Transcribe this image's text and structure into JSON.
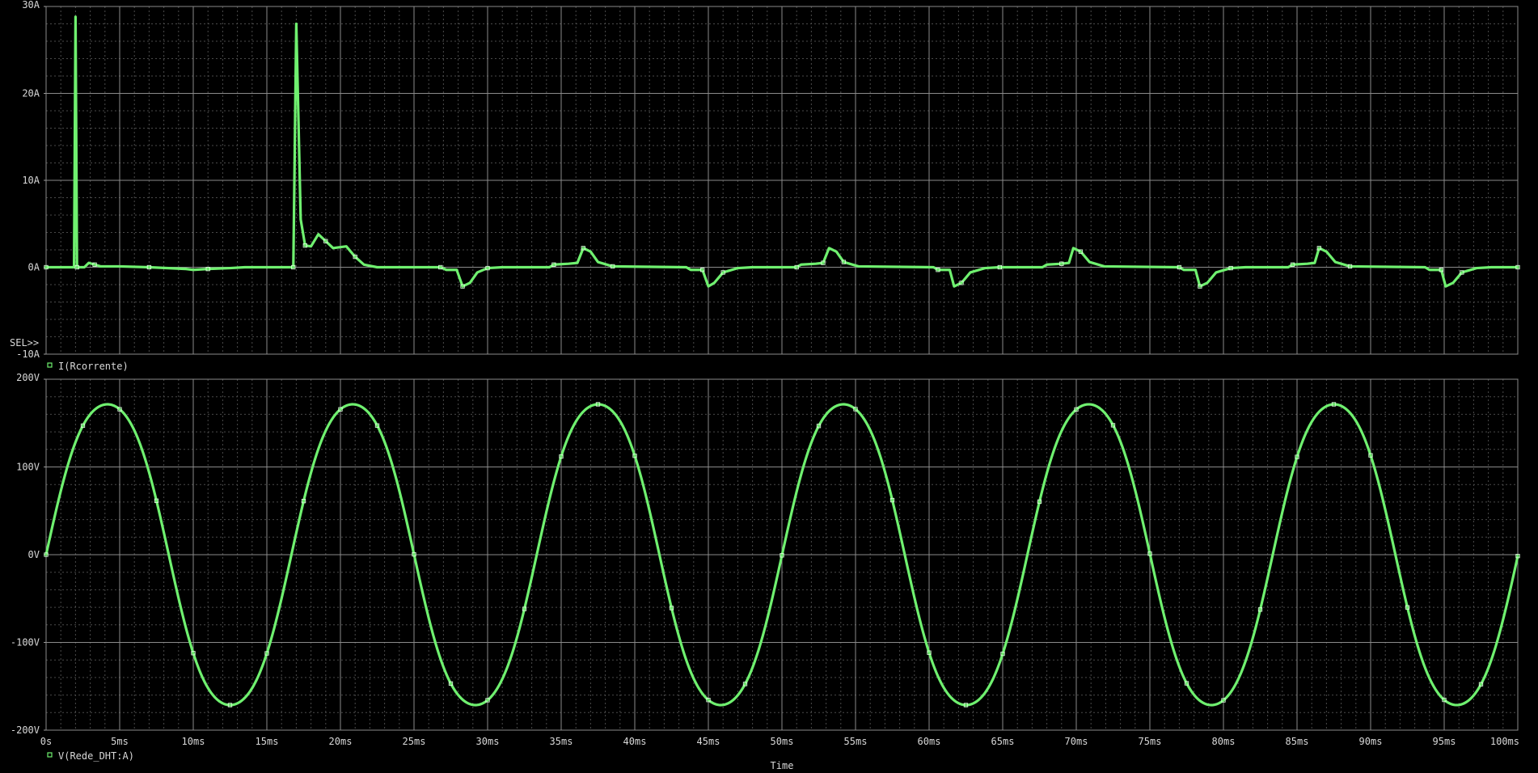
{
  "chart_data": [
    {
      "type": "line",
      "title": "",
      "xlabel": "",
      "ylabel": "",
      "xlim": [
        0,
        100
      ],
      "ylim": [
        -10,
        30
      ],
      "y_ticks": [
        "30A",
        "20A",
        "10A",
        "0A",
        "-10A"
      ],
      "y_tick_values": [
        30,
        20,
        10,
        0,
        -10
      ],
      "grid": true,
      "selection_marker": "SEL>>",
      "series": [
        {
          "name": "I(Rcorrente)",
          "color": "#6ff06f",
          "points": [
            [
              0,
              0
            ],
            [
              1.9,
              0
            ],
            [
              2.0,
              28.8
            ],
            [
              2.1,
              0
            ],
            [
              2.6,
              0
            ],
            [
              2.9,
              0.5
            ],
            [
              3.3,
              0.3
            ],
            [
              3.7,
              0.1
            ],
            [
              5,
              0.1
            ],
            [
              7,
              0
            ],
            [
              9.5,
              -0.2
            ],
            [
              10,
              -0.3
            ],
            [
              11,
              -0.2
            ],
            [
              12.5,
              -0.1
            ],
            [
              13.5,
              0
            ],
            [
              16.8,
              0
            ],
            [
              17.0,
              28.0
            ],
            [
              17.3,
              5.5
            ],
            [
              17.6,
              2.5
            ],
            [
              18.0,
              2.4
            ],
            [
              18.5,
              3.8
            ],
            [
              19.0,
              3.0
            ],
            [
              19.5,
              2.2
            ],
            [
              20.4,
              2.4
            ],
            [
              21.0,
              1.2
            ],
            [
              21.6,
              0.3
            ],
            [
              22.5,
              0
            ],
            [
              26.8,
              0
            ],
            [
              27.2,
              -0.3
            ],
            [
              27.9,
              -0.3
            ],
            [
              28.3,
              -2.2
            ],
            [
              28.8,
              -1.8
            ],
            [
              29.3,
              -0.6
            ],
            [
              30,
              -0.1
            ],
            [
              31,
              0
            ],
            [
              34.2,
              0
            ],
            [
              34.5,
              0.3
            ],
            [
              35.5,
              0.4
            ],
            [
              36.1,
              0.5
            ],
            [
              36.5,
              2.2
            ],
            [
              37.0,
              1.8
            ],
            [
              37.5,
              0.6
            ],
            [
              38.5,
              0.1
            ],
            [
              43.5,
              0
            ],
            [
              43.8,
              -0.3
            ],
            [
              44.6,
              -0.3
            ],
            [
              45.0,
              -2.2
            ],
            [
              45.4,
              -1.8
            ],
            [
              46.0,
              -0.6
            ],
            [
              47,
              -0.1
            ],
            [
              48,
              0
            ],
            [
              51,
              0
            ],
            [
              51.3,
              0.3
            ],
            [
              52.3,
              0.4
            ],
            [
              52.8,
              0.5
            ],
            [
              53.2,
              2.2
            ],
            [
              53.7,
              1.8
            ],
            [
              54.2,
              0.6
            ],
            [
              55.2,
              0.1
            ],
            [
              60.3,
              0
            ],
            [
              60.6,
              -0.3
            ],
            [
              61.4,
              -0.3
            ],
            [
              61.7,
              -2.2
            ],
            [
              62.2,
              -1.8
            ],
            [
              62.8,
              -0.6
            ],
            [
              63.8,
              -0.1
            ],
            [
              64.8,
              0
            ],
            [
              67.7,
              0
            ],
            [
              68,
              0.3
            ],
            [
              69,
              0.4
            ],
            [
              69.5,
              0.5
            ],
            [
              69.8,
              2.2
            ],
            [
              70.3,
              1.8
            ],
            [
              70.9,
              0.6
            ],
            [
              71.9,
              0.1
            ],
            [
              77,
              0
            ],
            [
              77.3,
              -0.3
            ],
            [
              78.1,
              -0.3
            ],
            [
              78.4,
              -2.2
            ],
            [
              78.9,
              -1.8
            ],
            [
              79.5,
              -0.6
            ],
            [
              80.5,
              -0.1
            ],
            [
              81.5,
              0
            ],
            [
              84.4,
              0
            ],
            [
              84.7,
              0.3
            ],
            [
              85.7,
              0.4
            ],
            [
              86.2,
              0.5
            ],
            [
              86.5,
              2.2
            ],
            [
              87.0,
              1.8
            ],
            [
              87.6,
              0.6
            ],
            [
              88.6,
              0.1
            ],
            [
              93.7,
              0
            ],
            [
              94,
              -0.3
            ],
            [
              94.8,
              -0.3
            ],
            [
              95.1,
              -2.2
            ],
            [
              95.6,
              -1.8
            ],
            [
              96.2,
              -0.6
            ],
            [
              97.2,
              -0.1
            ],
            [
              98.2,
              0
            ],
            [
              100,
              0
            ]
          ]
        }
      ]
    },
    {
      "type": "line",
      "title": "",
      "xlabel": "Time",
      "ylabel": "",
      "xlim": [
        0,
        100
      ],
      "ylim": [
        -200,
        200
      ],
      "x_ticks": [
        "0s",
        "5ms",
        "10ms",
        "15ms",
        "20ms",
        "25ms",
        "30ms",
        "35ms",
        "40ms",
        "45ms",
        "50ms",
        "55ms",
        "60ms",
        "65ms",
        "70ms",
        "75ms",
        "80ms",
        "85ms",
        "90ms",
        "95ms",
        "100ms"
      ],
      "y_ticks": [
        "200V",
        "100V",
        "0V",
        "-100V",
        "-200V"
      ],
      "y_tick_values": [
        200,
        100,
        0,
        -100,
        -200
      ],
      "grid": true,
      "series": [
        {
          "name": "V(Rede_DHT:A)",
          "color": "#6ff06f",
          "period_ms": 16.67,
          "amplitude": 180,
          "flattening": 0.12
        }
      ]
    }
  ]
}
